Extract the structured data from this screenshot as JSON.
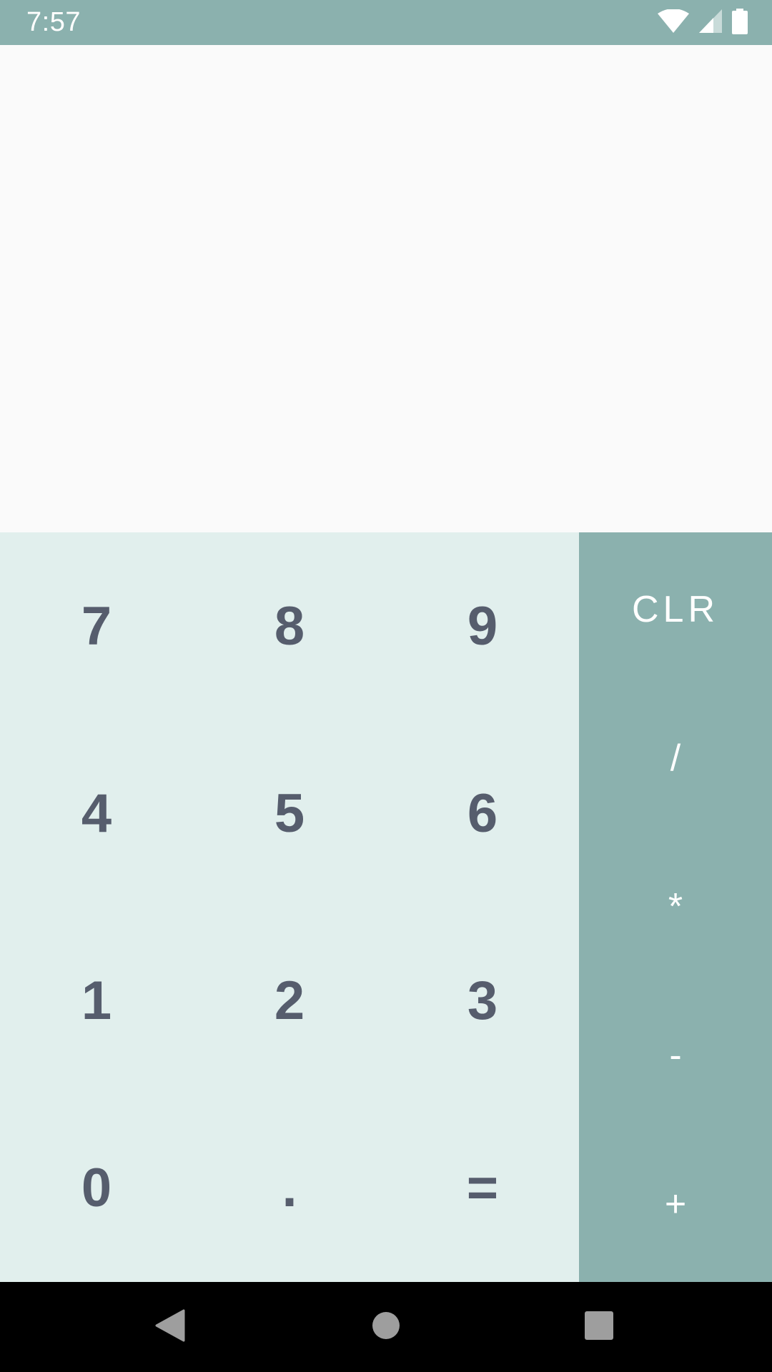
{
  "status_bar": {
    "time": "7:57",
    "background": "#8bb1ae",
    "icons": [
      "wifi-icon",
      "signal-icon",
      "battery-icon"
    ]
  },
  "display": {
    "expression": ""
  },
  "keypad": {
    "rows": [
      [
        "7",
        "8",
        "9"
      ],
      [
        "4",
        "5",
        "6"
      ],
      [
        "1",
        "2",
        "3"
      ],
      [
        "0",
        ".",
        "="
      ]
    ],
    "key_color": "#565d6d",
    "background": "#e1efed"
  },
  "operators": {
    "clear": "CLR",
    "divide": "/",
    "multiply": "*",
    "subtract": "-",
    "add": "+",
    "background": "#8bb1ae"
  },
  "nav_bar": {
    "icons": [
      "back-icon",
      "home-icon",
      "recents-icon"
    ]
  }
}
